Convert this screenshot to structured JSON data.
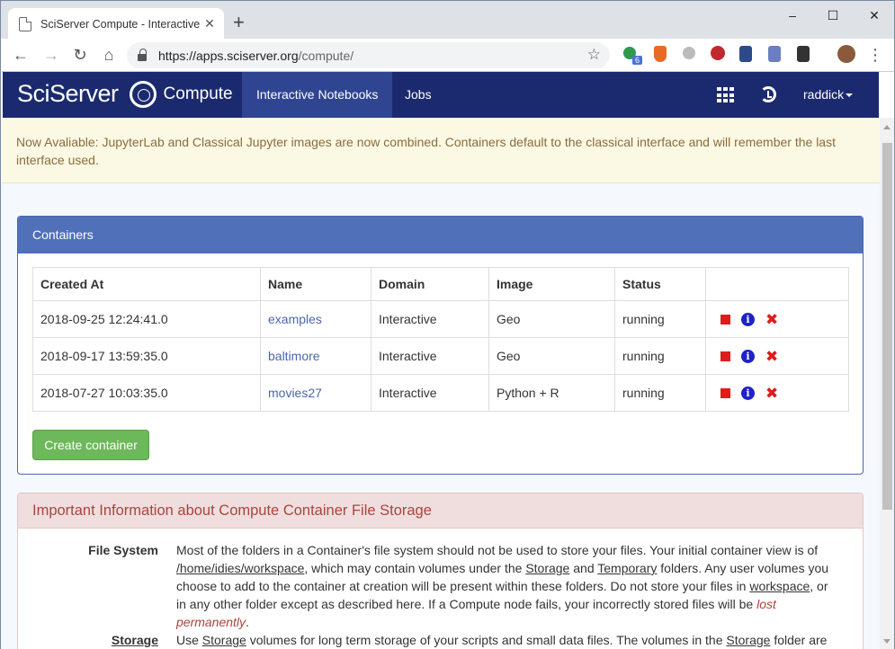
{
  "browser": {
    "tab_title": "SciServer Compute - Interactive V",
    "url_host": "https://apps.sciserver.org",
    "url_path": "/compute/",
    "extension_badge": "6"
  },
  "navbar": {
    "brand_main": "SciServer",
    "brand_sub": "Compute",
    "links": [
      "Interactive Notebooks",
      "Jobs"
    ],
    "user": "raddick"
  },
  "notice": "Now Avaliable: JupyterLab and Classical Jupyter images are now combined. Containers default to the classical interface and will remember the last interface used.",
  "containers": {
    "title": "Containers",
    "headers": [
      "Created At",
      "Name",
      "Domain",
      "Image",
      "Status",
      ""
    ],
    "rows": [
      {
        "created": "2018-09-25 12:24:41.0",
        "name": "examples",
        "domain": "Interactive",
        "image": "Geo",
        "status": "running"
      },
      {
        "created": "2018-09-17 13:59:35.0",
        "name": "baltimore",
        "domain": "Interactive",
        "image": "Geo",
        "status": "running"
      },
      {
        "created": "2018-07-27 10:03:35.0",
        "name": "movies27",
        "domain": "Interactive",
        "image": "Python + R",
        "status": "running"
      }
    ],
    "create_label": "Create container"
  },
  "storage_info": {
    "title": "Important Information about Compute Container File Storage",
    "file_system_label": "File System",
    "file_system_parts": {
      "t1": "Most of the folders in a Container's file system should not be used to store your files. Your initial container view is of ",
      "path": "/home/idies/workspace",
      "t2": ", which may contain volumes under the ",
      "storage": "Storage",
      "t3": " and ",
      "temporary": "Temporary",
      "t4": " folders. Any user volumes you choose to add to the container at creation will be present within these folders. Do not store your files in ",
      "workspace": "workspace",
      "t5": ", or in any other folder except as described here. If a Compute node fails, your incorrectly stored files will be ",
      "lost": "lost permanently",
      "t6": "."
    },
    "storage_label": "Storage",
    "storage_parts": {
      "t1": "Use ",
      "storage": "Storage",
      "t2": " volumes for long term storage of your scripts and small data files. The volumes in the ",
      "storage2": "Storage",
      "t3": " folder are"
    }
  }
}
